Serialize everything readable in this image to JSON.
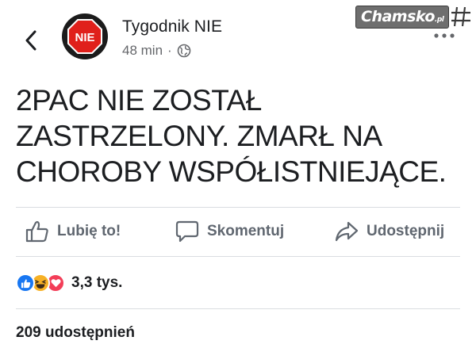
{
  "header": {
    "back_icon": "chevron-left-icon",
    "avatar_text": "NIE",
    "page_name": "Tygodnik NIE",
    "time": "48 min",
    "separator": "·",
    "visibility_icon": "globe-icon",
    "more_icon": "more-dots-icon"
  },
  "watermark": {
    "text": "Chamsko",
    "suffix": ".pl"
  },
  "post": {
    "lines": [
      "2PAC NIE ZOSTAŁ",
      "ZASTRZELONY. ZMARŁ NA",
      "CHOROBY WSPÓŁISTNIEJĄCE."
    ]
  },
  "actions": {
    "like": "Lubię to!",
    "comment": "Skomentuj",
    "share": "Udostępnij"
  },
  "reactions": {
    "types": [
      "like",
      "haha",
      "love"
    ],
    "count": "3,3 tys."
  },
  "shares": {
    "text": "209 udostępnień"
  },
  "colors": {
    "text": "#1c1e21",
    "secondary": "#65676b",
    "action": "#606770",
    "like_blue": "#1877f2",
    "haha_yellow": "#f7b125",
    "love_red": "#f33e58",
    "divider": "#dadde1"
  }
}
